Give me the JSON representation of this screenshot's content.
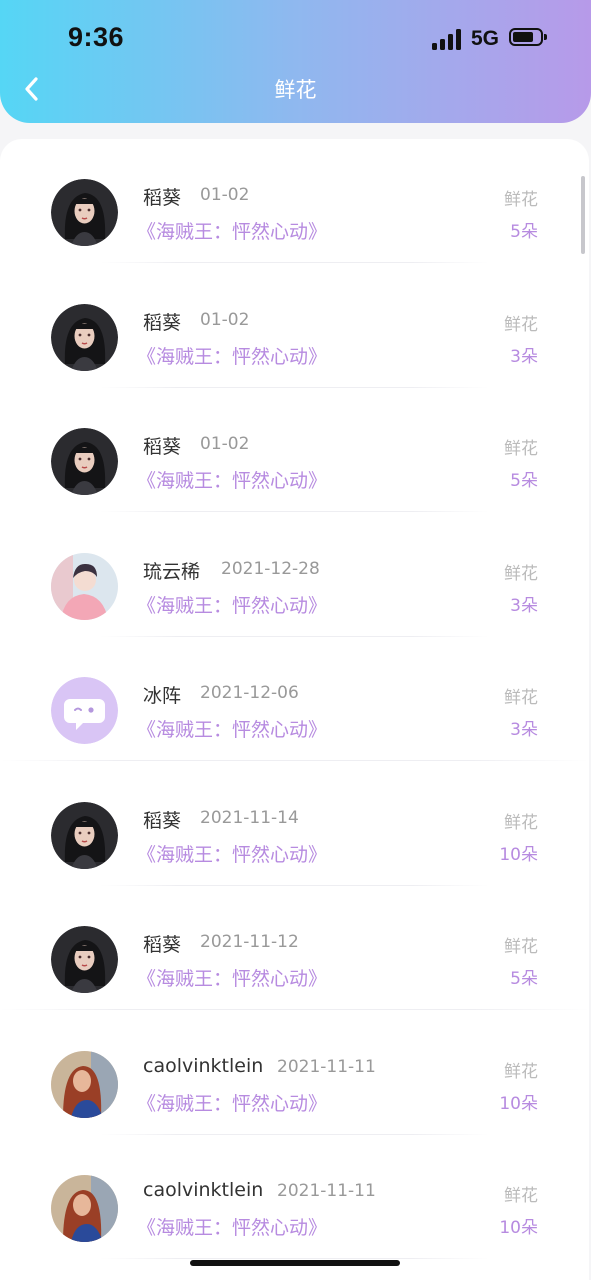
{
  "status_bar": {
    "time": "9:36",
    "network": "5G"
  },
  "header": {
    "title": "鲜花",
    "gradient": [
      "#55d6f5",
      "#b79ae9"
    ]
  },
  "colors": {
    "accent": "#b78be0"
  },
  "rows": [
    {
      "name": "稻葵",
      "date": "01-02",
      "title": "《海贼王：怦然心动》",
      "gift_label": "鲜花",
      "gift_count": "5朵",
      "avatar": "dark-hair-avatar"
    },
    {
      "name": "稻葵",
      "date": "01-02",
      "title": "《海贼王：怦然心动》",
      "gift_label": "鲜花",
      "gift_count": "3朵",
      "avatar": "dark-hair-avatar"
    },
    {
      "name": "稻葵",
      "date": "01-02",
      "title": "《海贼王：怦然心动》",
      "gift_label": "鲜花",
      "gift_count": "5朵",
      "avatar": "dark-hair-avatar"
    },
    {
      "name": "琉云稀",
      "date": "2021-12-28",
      "title": "《海贼王：怦然心动》",
      "gift_label": "鲜花",
      "gift_count": "3朵",
      "avatar": "pink-outfit-avatar"
    },
    {
      "name": "冰阵",
      "date": "2021-12-06",
      "title": "《海贼王：怦然心动》",
      "gift_label": "鲜花",
      "gift_count": "3朵",
      "avatar": "chat-bubble-avatar"
    },
    {
      "name": "稻葵",
      "date": "2021-11-14",
      "title": "《海贼王：怦然心动》",
      "gift_label": "鲜花",
      "gift_count": "10朵",
      "avatar": "dark-hair-avatar"
    },
    {
      "name": "稻葵",
      "date": "2021-11-12",
      "title": "《海贼王：怦然心动》",
      "gift_label": "鲜花",
      "gift_count": "5朵",
      "avatar": "dark-hair-avatar"
    },
    {
      "name": "caolvinktlein",
      "date": "2021-11-11",
      "title": "《海贼王：怦然心动》",
      "gift_label": "鲜花",
      "gift_count": "10朵",
      "avatar": "red-hair-avatar"
    },
    {
      "name": "caolvinktlein",
      "date": "2021-11-11",
      "title": "《海贼王：怦然心动》",
      "gift_label": "鲜花",
      "gift_count": "10朵",
      "avatar": "red-hair-avatar"
    }
  ]
}
